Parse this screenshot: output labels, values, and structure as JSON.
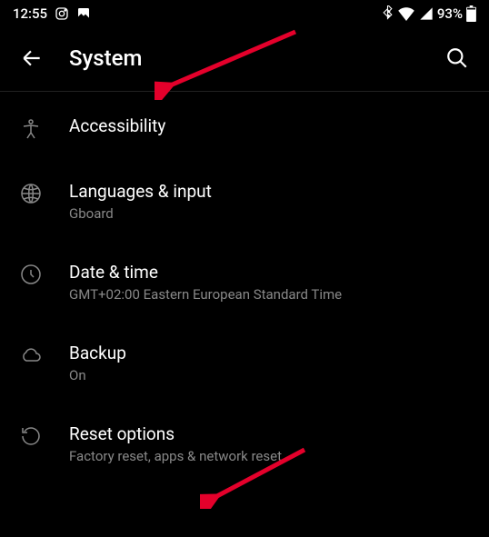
{
  "status": {
    "time": "12:55",
    "battery": "93%"
  },
  "header": {
    "title": "System"
  },
  "items": [
    {
      "title": "Accessibility",
      "subtitle": ""
    },
    {
      "title": "Languages & input",
      "subtitle": "Gboard"
    },
    {
      "title": "Date & time",
      "subtitle": "GMT+02:00 Eastern European Standard Time"
    },
    {
      "title": "Backup",
      "subtitle": "On"
    },
    {
      "title": "Reset options",
      "subtitle": "Factory reset, apps & network reset"
    }
  ]
}
